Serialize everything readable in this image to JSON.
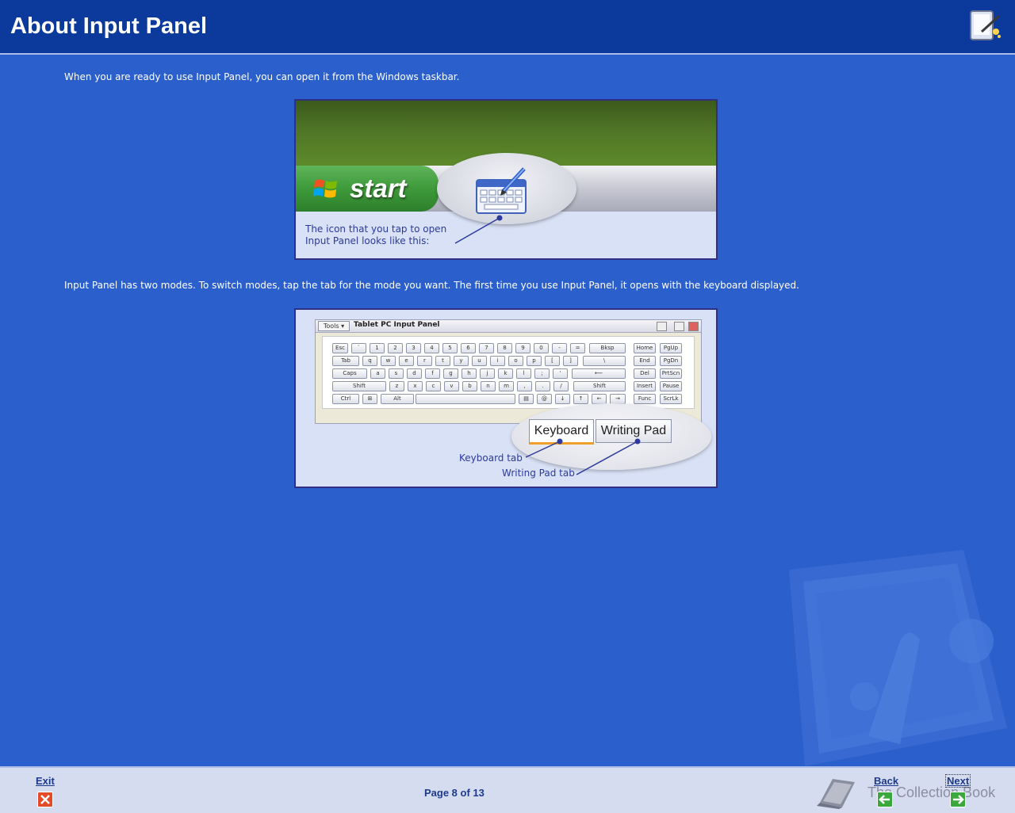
{
  "header": {
    "title": "About Input Panel",
    "logo_icon": "tablet-pc-pen-icon"
  },
  "main": {
    "paragraph1": "When you are ready to use Input Panel, you can open it from the Windows taskbar.",
    "figure1": {
      "start_label": "start",
      "caption": "The icon that you tap to open Input Panel looks like this:"
    },
    "paragraph2": "Input Panel has two modes. To switch modes, tap the tab for the mode you want. The first time you use Input Panel, it opens with the keyboard displayed.",
    "figure2": {
      "tools_label": "Tools",
      "window_title": "Tablet PC Input Panel",
      "keys": {
        "row1": [
          "Esc",
          "`",
          "1",
          "2",
          "3",
          "4",
          "5",
          "6",
          "7",
          "8",
          "9",
          "0",
          "-",
          "=",
          "Bksp"
        ],
        "row2": [
          "Tab",
          "q",
          "w",
          "e",
          "r",
          "t",
          "y",
          "u",
          "i",
          "o",
          "p",
          "[",
          "]",
          "\\"
        ],
        "row3": [
          "Caps",
          "a",
          "s",
          "d",
          "f",
          "g",
          "h",
          "j",
          "k",
          "l",
          ";",
          "'",
          "⟵"
        ],
        "row4": [
          "Shift",
          "z",
          "x",
          "c",
          "v",
          "b",
          "n",
          "m",
          ",",
          ".",
          "/",
          "Shift"
        ],
        "row5": [
          "Ctrl",
          "⊞",
          "Alt",
          "",
          "▤",
          "@",
          "↓",
          "↑",
          "←",
          "→"
        ],
        "nav": [
          [
            "Home",
            "PgUp"
          ],
          [
            "End",
            "PgDn"
          ],
          [
            "Del",
            "PrtScn"
          ],
          [
            "Insert",
            "Pause"
          ],
          [
            "Func",
            "ScrLk"
          ]
        ]
      },
      "tab_keyboard": "Keyboard",
      "tab_writing_pad": "Writing Pad",
      "label_keyboard_tab": "Keyboard tab",
      "label_writing_pad_tab": "Writing Pad tab"
    }
  },
  "footer": {
    "exit_label": "Exit",
    "page_indicator": "Page 8 of 13",
    "book_caption": "The Collection Book",
    "back_label": "Back",
    "next_label": "Next"
  }
}
